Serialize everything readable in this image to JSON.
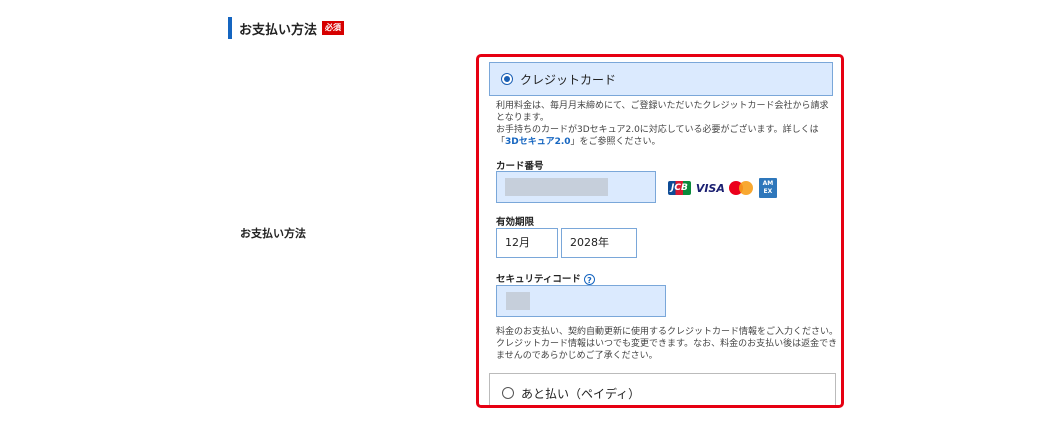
{
  "section": {
    "title": "お支払い方法",
    "required_badge": "必須"
  },
  "row_label": "お支払い方法",
  "credit_option": {
    "label": "クレジットカード",
    "selected": true,
    "description_1": "利用料金は、毎月月末締めにて、ご登録いただいたクレジットカード会社から請求となります。",
    "description_2": "お手持ちのカードが3Dセキュア2.0に対応している必要がございます。詳しくは「",
    "description_link": "3Dセキュア2.0",
    "description_3": "」をご参照ください。"
  },
  "card_number": {
    "label": "カード番号",
    "value": ""
  },
  "card_brands": [
    "JCB",
    "VISA",
    "Mastercard",
    "AMERICAN EXPRESS"
  ],
  "brand_labels": {
    "jcb": "JCB",
    "visa": "VISA",
    "amex": "AM EX"
  },
  "expiry": {
    "label": "有効期限",
    "month": "12月",
    "year": "2028年"
  },
  "security_code": {
    "label": "セキュリティコード",
    "help_icon": "?",
    "value": ""
  },
  "notice": "料金のお支払い、契約自動更新に使用するクレジットカード情報をご入力ください。クレジットカード情報はいつでも変更できます。なお、料金のお支払い後は返金できませんのであらかじめご了承ください。",
  "later_option": {
    "label": "あと払い（ペイディ）",
    "selected": false
  },
  "colors": {
    "accent": "#1565c0",
    "highlight_border": "#e60012",
    "input_bg": "#dbeafe",
    "required_bg": "#d60000"
  }
}
